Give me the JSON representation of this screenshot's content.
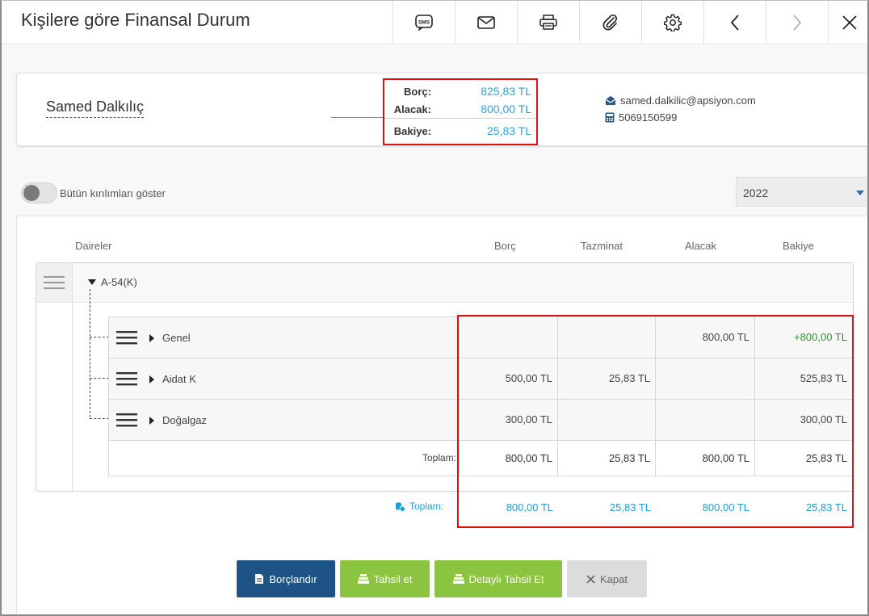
{
  "window": {
    "title": "Kişilere göre Finansal Durum"
  },
  "toolbar": {
    "sms_label": "SMS"
  },
  "summary": {
    "name": "Samed Dalkılıç",
    "borc_label": "Borç:",
    "borc_value": "825,83 TL",
    "alacak_label": "Alacak:",
    "alacak_value": "800,00 TL",
    "bakiye_label": "Bakiye:",
    "bakiye_value": "25,83 TL",
    "email": "samed.dalkilic@apsiyon.com",
    "phone": "5069150599",
    "highlight_color": "#e01010",
    "value_color": "#29a6e0"
  },
  "filters": {
    "toggle_label": "Bütün kırılımları göster",
    "toggle_on": false,
    "year": "2022"
  },
  "table": {
    "headers": {
      "daireler": "Daireler",
      "borc": "Borç",
      "tazminat": "Tazminat",
      "alacak": "Alacak",
      "bakiye": "Bakiye"
    },
    "parent": "A-54(K)",
    "rows": [
      {
        "name": "Genel",
        "borc": "",
        "tazminat": "",
        "alacak": "800,00 TL",
        "bakiye": "+800,00 TL",
        "bakiye_color": "#2a9a2a"
      },
      {
        "name": "Aidat K",
        "borc": "500,00 TL",
        "tazminat": "25,83 TL",
        "alacak": "",
        "bakiye": "525,83 TL",
        "bakiye_color": "#444444"
      },
      {
        "name": "Doğalgaz",
        "borc": "300,00 TL",
        "tazminat": "",
        "alacak": "",
        "bakiye": "300,00 TL",
        "bakiye_color": "#444444"
      }
    ],
    "subtotal": {
      "label": "Toplam:",
      "borc": "800,00 TL",
      "tazminat": "25,83 TL",
      "alacak": "800,00 TL",
      "bakiye": "25,83 TL"
    },
    "grand_total": {
      "label": "Toplam:",
      "borc": "800,00 TL",
      "tazminat": "25,83 TL",
      "alacak": "800,00 TL",
      "bakiye": "25,83 TL",
      "color": "#1e9fd8"
    }
  },
  "actions": {
    "borclandir": "Borçlandır",
    "tahsil_et": "Tahsil et",
    "detayli_tahsil_et": "Detaylı Tahsil Et",
    "kapat": "Kapat"
  }
}
